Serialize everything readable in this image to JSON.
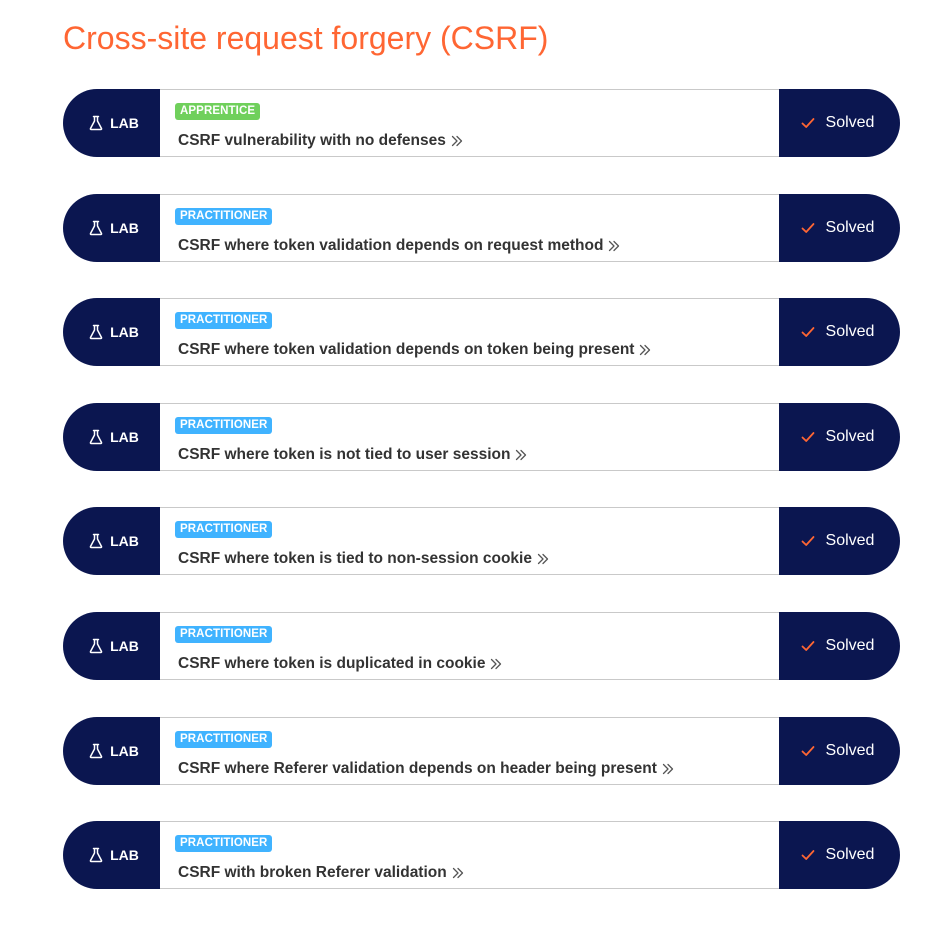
{
  "page": {
    "title": "Cross-site request forgery (CSRF)"
  },
  "colors": {
    "title": "#ff6633",
    "navy": "#0b1650",
    "apprentice": "#70d05c",
    "practitioner": "#40b3ff",
    "check": "#ff6633"
  },
  "labs": [
    {
      "type_label": "LAB",
      "level": "APPRENTICE",
      "level_kind": "apprentice",
      "title": "CSRF vulnerability with no defenses",
      "status": "Solved",
      "icon": "flask-icon"
    },
    {
      "type_label": "LAB",
      "level": "PRACTITIONER",
      "level_kind": "practitioner",
      "title": "CSRF where token validation depends on request method",
      "status": "Solved",
      "icon": "flask-icon"
    },
    {
      "type_label": "LAB",
      "level": "PRACTITIONER",
      "level_kind": "practitioner",
      "title": "CSRF where token validation depends on token being present",
      "status": "Solved",
      "icon": "flask-icon"
    },
    {
      "type_label": "LAB",
      "level": "PRACTITIONER",
      "level_kind": "practitioner",
      "title": "CSRF where token is not tied to user session",
      "status": "Solved",
      "icon": "flask-icon"
    },
    {
      "type_label": "LAB",
      "level": "PRACTITIONER",
      "level_kind": "practitioner",
      "title": "CSRF where token is tied to non-session cookie",
      "status": "Solved",
      "icon": "flask-icon"
    },
    {
      "type_label": "LAB",
      "level": "PRACTITIONER",
      "level_kind": "practitioner",
      "title": "CSRF where token is duplicated in cookie",
      "status": "Solved",
      "icon": "flask-icon"
    },
    {
      "type_label": "LAB",
      "level": "PRACTITIONER",
      "level_kind": "practitioner",
      "title": "CSRF where Referer validation depends on header being present",
      "status": "Solved",
      "icon": "flask-icon"
    },
    {
      "type_label": "LAB",
      "level": "PRACTITIONER",
      "level_kind": "practitioner",
      "title": "CSRF with broken Referer validation",
      "status": "Solved",
      "icon": "flask-icon"
    }
  ]
}
